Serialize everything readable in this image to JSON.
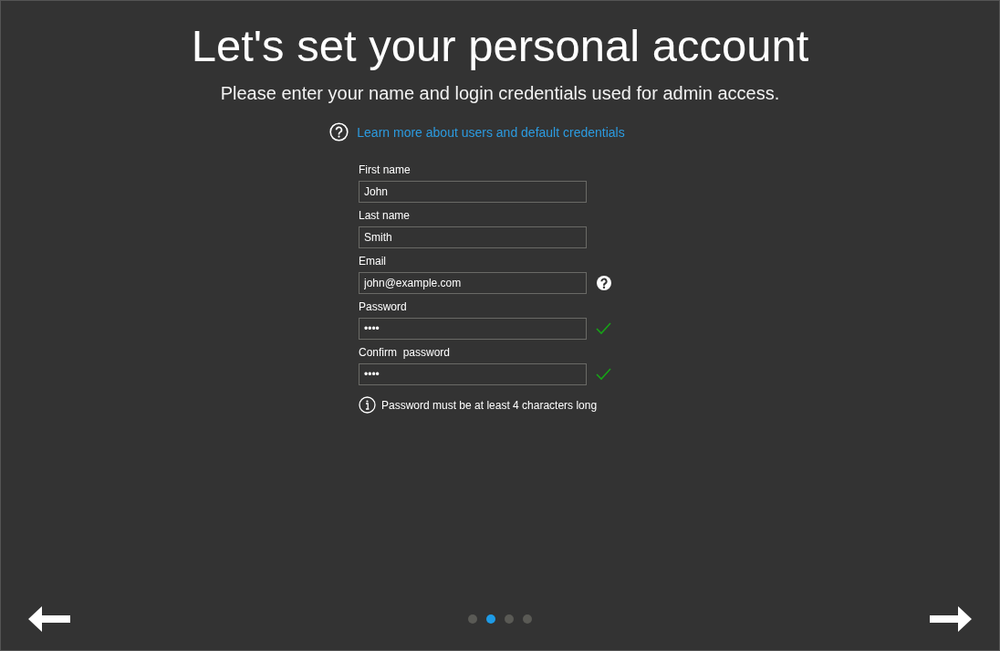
{
  "title": "Let's set your personal account",
  "subtitle": "Please enter your name and login credentials used for admin access.",
  "help_link": "Learn more about users and default credentials",
  "fields": [
    {
      "label": "First name",
      "value": "John",
      "kind": "plain"
    },
    {
      "label": "Last name",
      "value": "Smith",
      "kind": "plain"
    },
    {
      "label": "Email",
      "value": "john@example.com",
      "kind": "help"
    },
    {
      "label": "Password",
      "value": "••••",
      "kind": "valid"
    },
    {
      "label": "Confirm  password",
      "value": "••••",
      "kind": "valid"
    }
  ],
  "note": "Password must be at least 4 characters long",
  "pager": [
    {
      "selected": false
    },
    {
      "selected": true
    },
    {
      "selected": false
    },
    {
      "selected": false
    }
  ]
}
